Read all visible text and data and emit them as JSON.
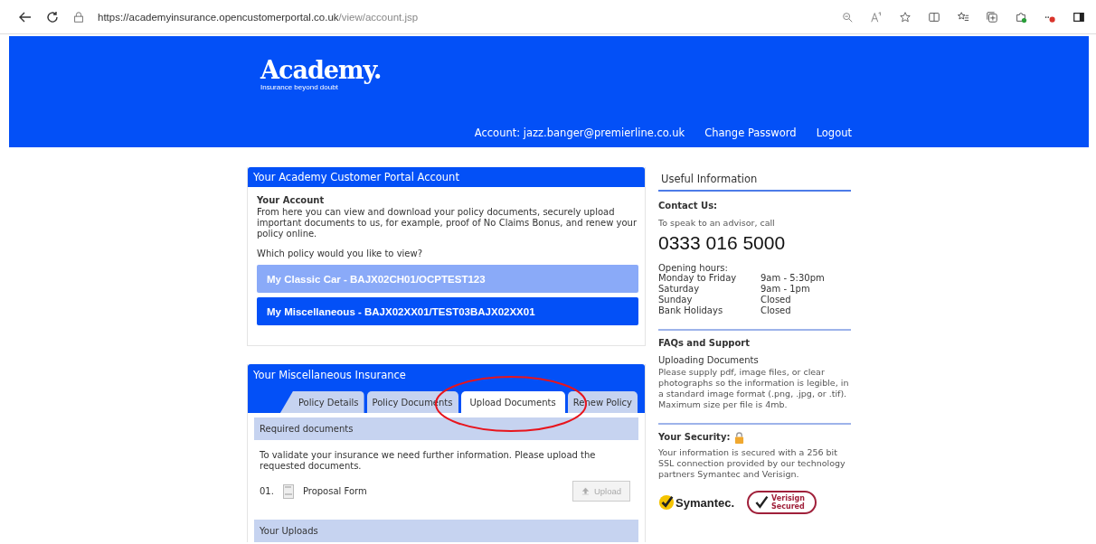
{
  "browser": {
    "url_host": "https://academyinsurance.opencustomerportal.co.uk",
    "url_path": "/view/account.jsp"
  },
  "header": {
    "logo": "Academy.",
    "tagline": "Insurance beyond doubt",
    "account": "Account: jazz.banger@premierline.co.uk",
    "links": [
      "Change Password",
      "Logout"
    ]
  },
  "account_panel": {
    "title": "Your Academy Customer Portal Account",
    "subtitle": "Your Account",
    "intro": "From here you can view and download your policy documents, securely upload important documents to us, for example, proof of No Claims Bonus, and renew your policy online.",
    "question": "Which policy would you like to view?",
    "policies": [
      {
        "label": "My Classic Car - BAJX02CH01/OCPTEST123",
        "selected": false
      },
      {
        "label": "My Miscellaneous - BAJX02XX01/TEST03BAJX02XX01",
        "selected": true
      }
    ]
  },
  "insurance_panel": {
    "title": "Your Miscellaneous Insurance",
    "tabs": [
      {
        "label": "Policy Details",
        "selected": false
      },
      {
        "label": "Policy Documents",
        "selected": false
      },
      {
        "label": "Upload Documents",
        "selected": true
      },
      {
        "label": "Renew Policy",
        "selected": false
      }
    ],
    "required_heading": "Required documents",
    "required_text": "To validate your insurance we need further information. Please upload the requested documents.",
    "documents": [
      {
        "number": "01.",
        "name": "Proposal Form",
        "button": "Upload",
        "disabled": true
      }
    ],
    "uploads_heading": "Your Uploads",
    "annotation": {
      "kind": "ellipse"
    }
  },
  "sidebar": {
    "title": "Useful Information",
    "contact_heading": "Contact Us:",
    "contact_text": "To speak to an advisor, call",
    "phone": "0333 016 5000",
    "hours_heading": "Opening hours:",
    "hours": [
      {
        "day": "Monday to Friday",
        "time": "9am - 5:30pm"
      },
      {
        "day": "Saturday",
        "time": "9am - 1pm"
      },
      {
        "day": "Sunday",
        "time": "Closed"
      },
      {
        "day": "Bank Holidays",
        "time": "Closed"
      }
    ],
    "faq_heading": "FAQs and Support",
    "faq_subheading": "Uploading Documents",
    "faq_text": "Please supply pdf, image files, or clear photographs so the information is legible, in a standard image format (.png, .jpg, or .tif). Maximum size per file is 4mb.",
    "security_heading": "Your Security:",
    "security_text": "Your information is secured with a 256 bit SSL connection provided by our technology partners Symantec and Verisign.",
    "seals": [
      "Symantec.",
      "Verisign Secured"
    ]
  }
}
